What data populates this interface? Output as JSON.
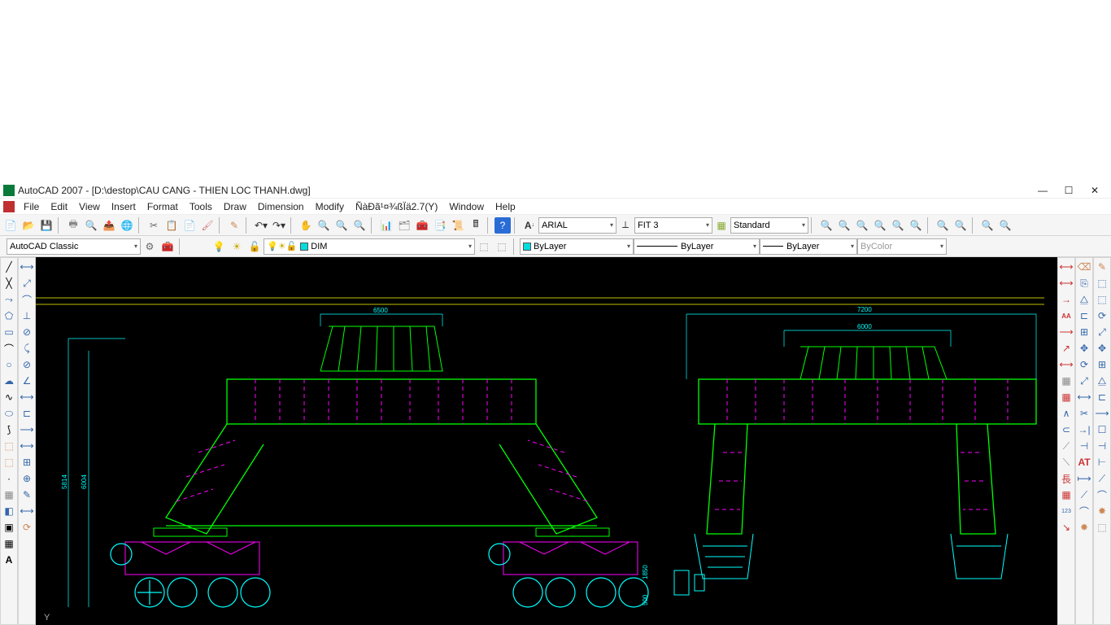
{
  "window": {
    "title": "AutoCAD 2007 - [D:\\destop\\CAU CANG - THIEN LOC THANH.dwg]"
  },
  "menu": {
    "items": [
      "File",
      "Edit",
      "View",
      "Insert",
      "Format",
      "Tools",
      "Draw",
      "Dimension",
      "Modify",
      "ÑàĐã¹¤¾ßÏä2.7(Y)",
      "Window",
      "Help"
    ]
  },
  "toolbar": {
    "font_dropdown": "ARIAL",
    "dimstyle_dropdown": "FIT 3",
    "tablestyle_dropdown": "Standard"
  },
  "props": {
    "workspace": "AutoCAD Classic",
    "layer": "DIM",
    "color_label": "ByLayer",
    "linetype_label": "ByLayer",
    "lineweight_label": "ByLayer",
    "plotstyle": "ByColor"
  },
  "dims": {
    "left_top": "6500",
    "right_top": "7200",
    "right_sub": "6000",
    "left_height": "5814",
    "left_height2": "6004",
    "right_v1": "1850",
    "right_v2": "500"
  },
  "colors": {
    "green": "#00ff00",
    "magenta": "#ff00ff",
    "cyan": "#00ffff",
    "yellow": "#ffff00",
    "red": "#ff0000"
  }
}
